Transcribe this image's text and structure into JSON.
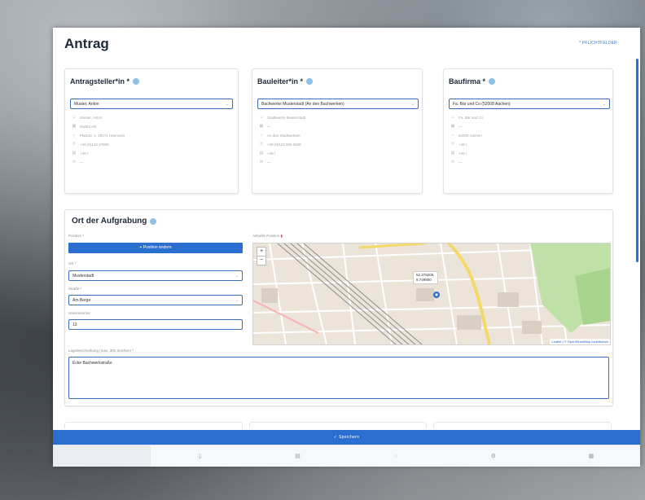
{
  "page": {
    "title": "Antrag",
    "required_note": "* PFLICHTFELDER"
  },
  "panels": [
    {
      "title": "Antragsteller*in *",
      "selected": "Muster, Anton",
      "lines": [
        {
          "icon": "person-icon",
          "glyph": "☺",
          "text": "Muster, Anton"
        },
        {
          "icon": "building-icon",
          "glyph": "▦",
          "text": "MuBet AG"
        },
        {
          "icon": "location-icon",
          "glyph": "⌂",
          "text": "Platzstr. 1, 30171 Hannover"
        },
        {
          "icon": "phone-icon",
          "glyph": "✆",
          "text": "+49 (0)123 47856"
        },
        {
          "icon": "fax-icon",
          "glyph": "▤",
          "text": "+49 /"
        },
        {
          "icon": "email-icon",
          "glyph": "✉",
          "text": "—"
        }
      ]
    },
    {
      "title": "Bauleiter*in *",
      "selected": "Bachwerke Musterstadt (An den Bachwerken)",
      "lines": [
        {
          "icon": "person-icon",
          "glyph": "☺",
          "text": "Stadtwerke Musterstadt"
        },
        {
          "icon": "building-icon",
          "glyph": "▦",
          "text": "—"
        },
        {
          "icon": "location-icon",
          "glyph": "⌂",
          "text": "An den Stadtwerken"
        },
        {
          "icon": "phone-icon",
          "glyph": "✆",
          "text": "+49 (0)123 555 6530"
        },
        {
          "icon": "fax-icon",
          "glyph": "▤",
          "text": "+49 /"
        },
        {
          "icon": "email-icon",
          "glyph": "✉",
          "text": "—"
        }
      ]
    },
    {
      "title": "Baufirma *",
      "selected": "Fa. Bär und Co (52008 Aachen)",
      "lines": [
        {
          "icon": "person-icon",
          "glyph": "☺",
          "text": "Fa. Bär und Co"
        },
        {
          "icon": "building-icon",
          "glyph": "▦",
          "text": "—"
        },
        {
          "icon": "location-icon",
          "glyph": "⌂",
          "text": "52008 Aachen"
        },
        {
          "icon": "phone-icon",
          "glyph": "✆",
          "text": "+49 /"
        },
        {
          "icon": "fax-icon",
          "glyph": "▤",
          "text": "+49 /"
        },
        {
          "icon": "email-icon",
          "glyph": "✉",
          "text": "—"
        }
      ]
    }
  ],
  "location": {
    "title": "Ort der Aufgrabung",
    "position_label": "Position *",
    "position_button": "Position ändern",
    "ort_label": "Ort *",
    "ort_value": "Musterstadt",
    "strasse_label": "Straße *",
    "strasse_value": "Am Berge",
    "hausnummer_label": "Hausnummer",
    "hausnummer_value": "13",
    "aktuelle_position_label": "Aktuelle Position",
    "map_coords_line1": "52.379200,",
    "map_coords_line2": "9.749900",
    "map_attribution": "Leaflet | © OpenStreetMap contributors",
    "zoom_in": "+",
    "zoom_out": "−",
    "lage_label": "Lagebeschreibung (max. 300 Zeichen) *",
    "lage_value": "Ecke Bachwerkstraße"
  },
  "actions": {
    "save_label": "Speichern",
    "save_icon": "check-icon"
  },
  "bottom_nav": [
    {
      "icon": "home-icon",
      "glyph": ""
    },
    {
      "icon": "document-icon",
      "glyph": "▯"
    },
    {
      "icon": "list-icon",
      "glyph": "▤"
    },
    {
      "icon": "info-icon",
      "glyph": "◌"
    },
    {
      "icon": "settings-icon",
      "glyph": "⚙"
    },
    {
      "icon": "grid-icon",
      "glyph": "▦"
    }
  ],
  "colors": {
    "accent": "#2a6fcf",
    "info_icon": "#8fc0ea",
    "map_marker": "#2a6fcf"
  }
}
